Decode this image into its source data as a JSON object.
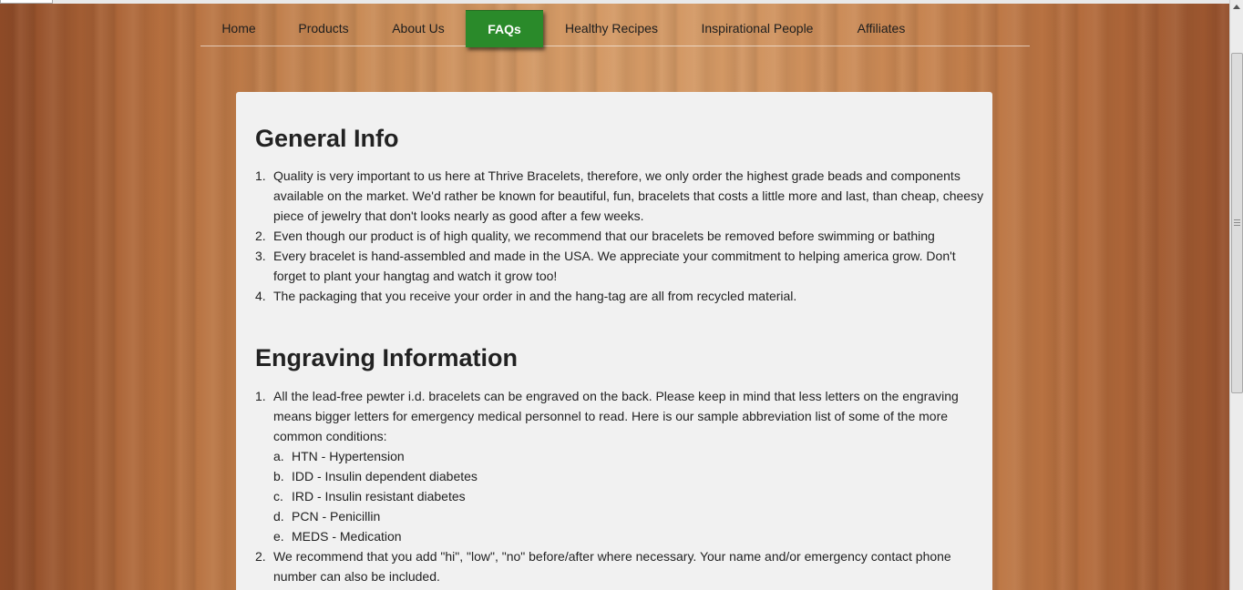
{
  "nav": {
    "items": [
      {
        "label": "Home"
      },
      {
        "label": "Products"
      },
      {
        "label": "About Us"
      },
      {
        "label": "FAQs"
      },
      {
        "label": "Healthy Recipes"
      },
      {
        "label": "Inspirational People"
      },
      {
        "label": "Affiliates"
      }
    ],
    "active": "FAQs"
  },
  "general": {
    "title": "General Info",
    "items": [
      {
        "num": "1.",
        "text": "Quality is very important to us here at Thrive Bracelets, therefore, we only order the highest grade beads and components available on the market. We'd rather be known for beautiful, fun, bracelets that costs a little more and last, than cheap, cheesy piece of jewelry that don't looks nearly as good after a few weeks."
      },
      {
        "num": "2.",
        "text": "Even though our product is of high quality, we recommend that our bracelets be removed before swimming or bathing"
      },
      {
        "num": "3.",
        "text": "Every bracelet is hand-assembled and made in the USA. We appreciate your commitment to helping america grow. Don't forget to plant your hangtag and watch it grow too!"
      },
      {
        "num": "4.",
        "text": "The packaging that you receive your order in and the hang-tag are all from recycled material."
      }
    ]
  },
  "engraving": {
    "title": "Engraving Information",
    "item1": {
      "num": "1.",
      "text": "All the lead-free pewter i.d. bracelets can be engraved on the back. Please keep in mind that less letters on the engraving means bigger letters for emergency medical personnel to read. Here is our sample abbreviation list of some of the more common conditions:",
      "sub": [
        {
          "num": "a.",
          "text": "HTN - Hypertension"
        },
        {
          "num": "b.",
          "text": "IDD - Insulin dependent diabetes"
        },
        {
          "num": "c.",
          "text": "IRD - Insulin resistant diabetes"
        },
        {
          "num": "d.",
          "text": "PCN - Penicillin"
        },
        {
          "num": "e.",
          "text": "MEDS - Medication"
        }
      ]
    },
    "item2": {
      "num": "2.",
      "text": "We recommend that you add \"hi\", \"low\", \"no\" before/after where necessary. Your name and/or emergency contact phone number can also be included."
    }
  },
  "colors": {
    "active_tab": "#2a8a2a",
    "panel": "#f1f1f1",
    "wood": "#c88a55"
  }
}
